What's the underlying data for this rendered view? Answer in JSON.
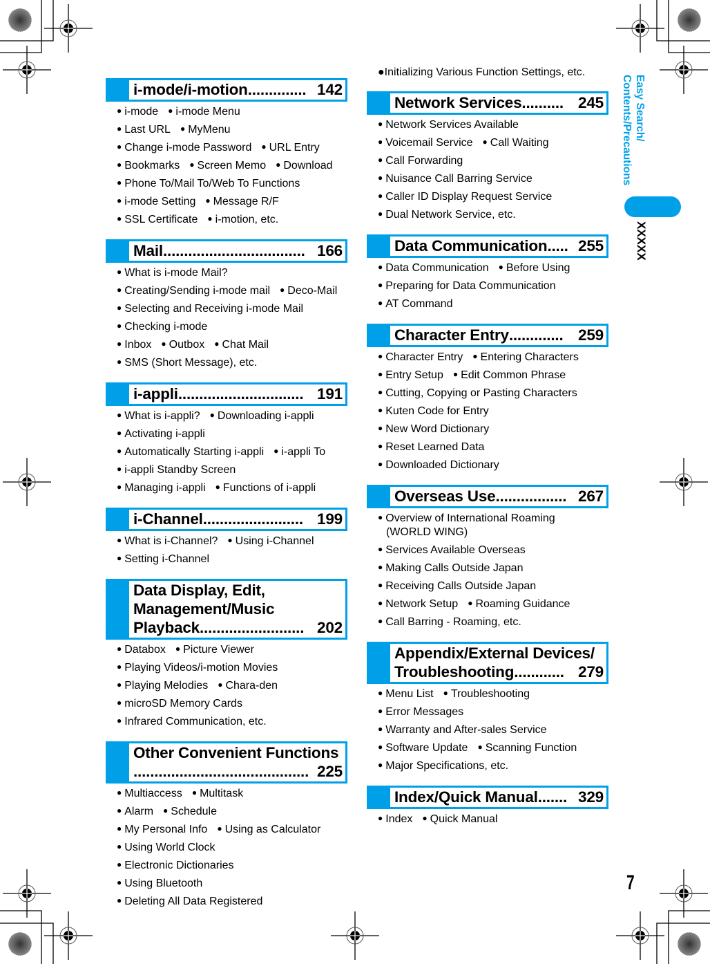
{
  "side_tab": {
    "line1": "Easy Search/",
    "line2": "Contents/Precautions",
    "chapter_label": "XXXXX",
    "accent_color": "#00a0e9"
  },
  "page_number": "7",
  "left_column": [
    {
      "title_lines": [],
      "title": "i-mode/i-motion",
      "dots": "..............",
      "page": "142",
      "lines": [
        [
          "i-mode",
          "i-mode Menu"
        ],
        [
          "Last URL",
          "MyMenu"
        ],
        [
          "Change i-mode Password",
          "URL Entry"
        ],
        [
          "Bookmarks",
          "Screen Memo",
          "Download"
        ],
        [
          "Phone To/Mail To/Web To Functions"
        ],
        [
          "i-mode Setting",
          "Message R/F"
        ],
        [
          "SSL Certificate",
          "i-motion, etc."
        ]
      ]
    },
    {
      "title_lines": [],
      "title": "Mail",
      "dots": "..................................",
      "page": "166",
      "lines": [
        [
          "What is i-mode Mail?"
        ],
        [
          "Creating/Sending i-mode mail",
          "Deco-Mail"
        ],
        [
          "Selecting and Receiving i-mode Mail"
        ],
        [
          "Checking i-mode"
        ],
        [
          "Inbox",
          "Outbox",
          "Chat Mail"
        ],
        [
          "SMS (Short Message), etc."
        ]
      ]
    },
    {
      "title_lines": [],
      "title": "i-appli ",
      "dots": "..............................",
      "page": "191",
      "lines": [
        [
          "What is i-appli?",
          "Downloading i-appli"
        ],
        [
          "Activating i-appli"
        ],
        [
          "Automatically Starting i-appli",
          "i-appli To"
        ],
        [
          "i-appli Standby Screen"
        ],
        [
          "Managing i-appli",
          "Functions of i-appli"
        ]
      ]
    },
    {
      "title_lines": [],
      "title": "i-Channel ",
      "dots": "........................",
      "page": "199",
      "lines": [
        [
          "What is i-Channel?",
          "Using i-Channel"
        ],
        [
          "Setting i-Channel"
        ]
      ]
    },
    {
      "title_lines": [
        "Data Display, Edit,",
        "Management/Music"
      ],
      "title": "Playback ",
      "dots": ".........................",
      "page": "202",
      "lines": [
        [
          "Databox",
          "Picture Viewer"
        ],
        [
          "Playing Videos/i-motion Movies"
        ],
        [
          "Playing Melodies",
          "Chara-den"
        ],
        [
          "microSD Memory Cards"
        ],
        [
          "Infrared Communication, etc."
        ]
      ]
    },
    {
      "title_lines": [
        "Other Convenient Functions"
      ],
      "title": "",
      "dots": "..........................................",
      "page": "225",
      "lines": [
        [
          "Multiaccess",
          "Multitask"
        ],
        [
          "Alarm",
          "Schedule"
        ],
        [
          "My Personal Info",
          "Using as Calculator"
        ],
        [
          "Using World Clock"
        ],
        [
          "Electronic Dictionaries"
        ],
        [
          "Using Bluetooth"
        ],
        [
          "Deleting All Data Registered"
        ]
      ]
    }
  ],
  "right_column_lead": "Initializing Various Function Settings, etc.",
  "right_column": [
    {
      "title_lines": [],
      "title": "Network Services ",
      "dots": "..........",
      "page": " 245",
      "lines": [
        [
          "Network Services Available"
        ],
        [
          "Voicemail Service",
          "Call Waiting"
        ],
        [
          "Call Forwarding"
        ],
        [
          "Nuisance Call Barring Service"
        ],
        [
          "Caller ID Display Request Service"
        ],
        [
          "Dual Network Service, etc."
        ]
      ]
    },
    {
      "title_lines": [],
      "title": "Data Communication",
      "dots": ".....",
      "page": " 255",
      "lines": [
        [
          "Data Communication",
          "Before Using"
        ],
        [
          "Preparing for Data Communication"
        ],
        [
          "AT Command"
        ]
      ]
    },
    {
      "title_lines": [],
      "title": "Character Entry ",
      "dots": ".............",
      "page": " 259",
      "lines": [
        [
          "Character Entry",
          "Entering Characters"
        ],
        [
          "Entry Setup",
          "Edit Common Phrase"
        ],
        [
          "Cutting, Copying or Pasting Characters"
        ],
        [
          "Kuten Code for Entry"
        ],
        [
          "New Word Dictionary"
        ],
        [
          "Reset Learned Data"
        ],
        [
          "Downloaded Dictionary"
        ]
      ]
    },
    {
      "title_lines": [],
      "title": "Overseas Use",
      "dots": ".................",
      "page": " 267",
      "lines": [
        [
          "Overview of International Roaming"
        ],
        [
          "(WORLD WING)"
        ],
        [
          "Services Available Overseas"
        ],
        [
          "Making Calls Outside Japan"
        ],
        [
          "Receiving Calls Outside Japan"
        ],
        [
          "Network Setup",
          "Roaming Guidance"
        ],
        [
          "Call Barring - Roaming, etc."
        ]
      ],
      "continuation_line_index": 1
    },
    {
      "title_lines": [
        "Appendix/External Devices/"
      ],
      "title": "Troubleshooting ",
      "dots": "............",
      "page": " 279",
      "lines": [
        [
          "Menu List",
          "Troubleshooting"
        ],
        [
          "Error Messages"
        ],
        [
          "Warranty and After-sales Service"
        ],
        [
          "Software Update",
          "Scanning Function"
        ],
        [
          "Major Specifications, etc."
        ]
      ]
    },
    {
      "title_lines": [],
      "title": "Index/Quick Manual",
      "dots": ".......",
      "page": " 329",
      "lines": [
        [
          "Index",
          "Quick Manual"
        ]
      ]
    }
  ]
}
